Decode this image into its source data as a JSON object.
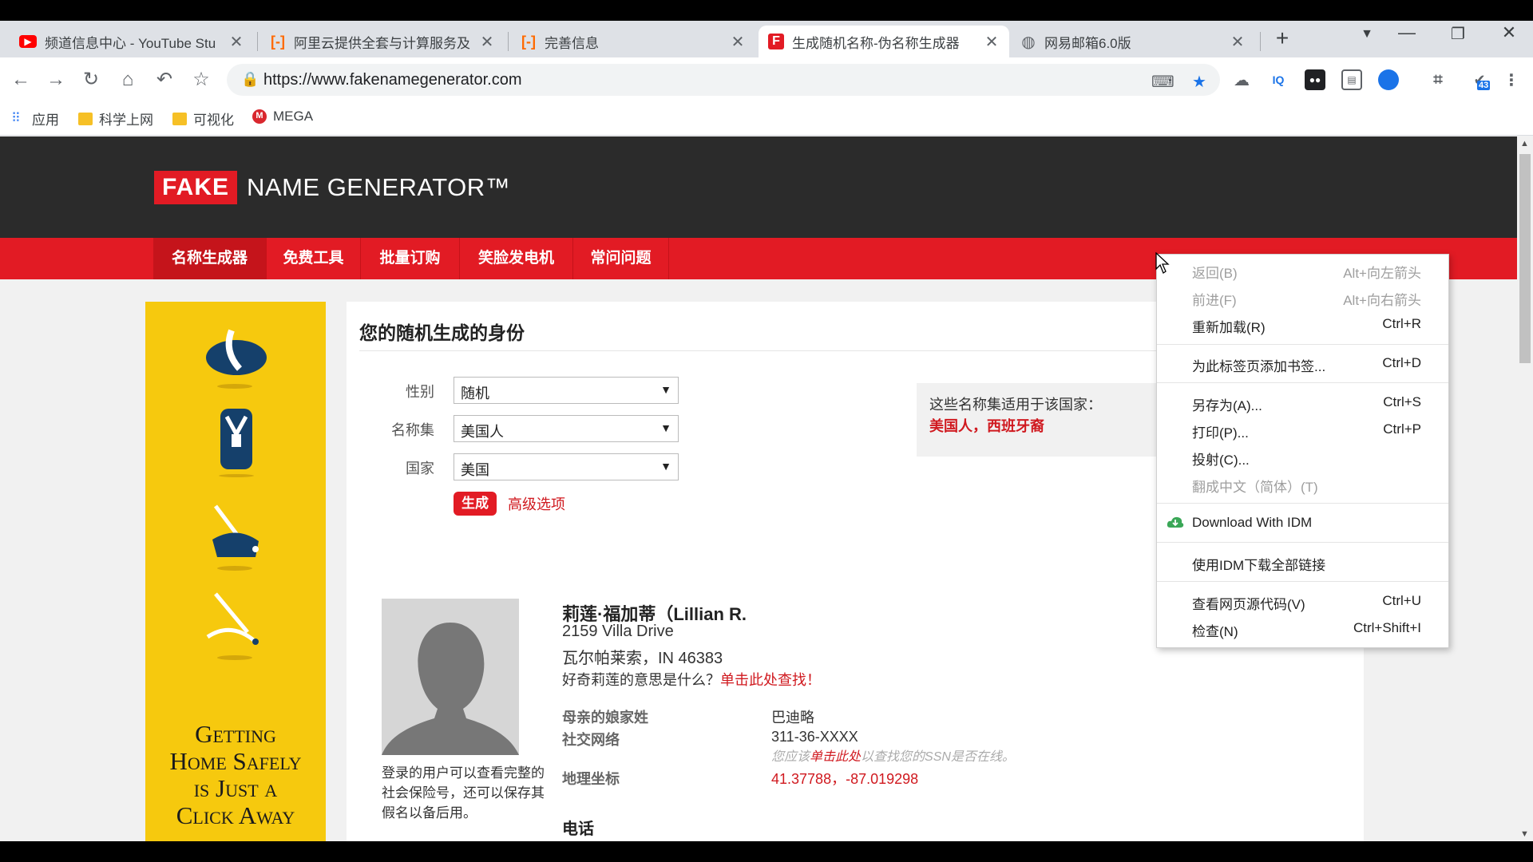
{
  "browser": {
    "tabs": [
      {
        "title": "频道信息中心 - YouTube Stu",
        "icon": "youtube-icon",
        "color": "#ff0000"
      },
      {
        "title": "阿里云提供全套与计算服务及",
        "icon": "aliyun-icon",
        "color": "#ff6a00"
      },
      {
        "title": "完善信息",
        "icon": "aliyun-icon",
        "color": "#ff6a00"
      },
      {
        "title": "生成随机名称-伪名称生成器",
        "icon": "fakename-icon",
        "color": "#e21b24",
        "active": true
      },
      {
        "title": "网易邮箱6.0版",
        "icon": "globe-icon",
        "color": "#5f6368"
      }
    ],
    "new_tab": "+",
    "url": "https://www.fakenamegenerator.com",
    "bookmarks": [
      {
        "label": "应用",
        "icon": "apps-grid-icon"
      },
      {
        "label": "科学上网",
        "icon": "folder-icon"
      },
      {
        "label": "可视化",
        "icon": "folder-icon"
      },
      {
        "label": "MEGA",
        "icon": "mega-icon"
      }
    ],
    "extension_badge": "43"
  },
  "site": {
    "logo_fake": "FAKE",
    "logo_rest": "NAME GENERATOR™",
    "nav": [
      "名称生成器",
      "免费工具",
      "批量订购",
      "笑脸发电机",
      "常问问题"
    ]
  },
  "ad": {
    "text_lines": [
      "Getting",
      "Home Safely",
      "is Just a",
      "Click Away"
    ]
  },
  "form": {
    "title": "您的随机生成的身份",
    "gender_label": "性别",
    "gender_value": "随机",
    "nameset_label": "名称集",
    "nameset_value": "美国人",
    "country_label": "国家",
    "country_value": "美国",
    "generate_button": "生成",
    "advanced_link": "高级选项",
    "note_line1": "这些名称集适用于该国家：",
    "note_line2": "美国人，西班牙裔"
  },
  "identity": {
    "name": "莉莲·福加蒂（Lillian R.",
    "address_line1": "2159 Villa Drive",
    "address_line2": "瓦尔帕莱索，IN 46383",
    "curious_text": "好奇莉莲的意思是什么？",
    "curious_link": "单击此处查找！",
    "login_note": "登录的用户可以查看完整的社会保险号，还可以保存其假名以备后用。",
    "fields": [
      {
        "key": "母亲的娘家姓",
        "value": "巴迪略"
      },
      {
        "key": "社交网络",
        "value": "311-36-XXXX"
      },
      {
        "key": "地理坐标",
        "value": "41.37788，-87.019298"
      }
    ],
    "ssn_hint_pre": "您应该",
    "ssn_hint_link": "单击此处",
    "ssn_hint_post": "以查找您的SSN是否在线。",
    "phone_heading": "电话"
  },
  "context_menu": {
    "items": [
      {
        "label": "返回(B)",
        "shortcut": "Alt+向左箭头",
        "disabled": true
      },
      {
        "label": "前进(F)",
        "shortcut": "Alt+向右箭头",
        "disabled": true
      },
      {
        "label": "重新加载(R)",
        "shortcut": "Ctrl+R"
      },
      {
        "label": "为此标签页添加书签...",
        "shortcut": "Ctrl+D"
      },
      {
        "label": "另存为(A)...",
        "shortcut": "Ctrl+S"
      },
      {
        "label": "打印(P)...",
        "shortcut": "Ctrl+P"
      },
      {
        "label": "投射(C)...",
        "shortcut": ""
      },
      {
        "label": "翻成中文（简体）(T)",
        "shortcut": "",
        "disabled": true
      },
      {
        "label": "Download With IDM",
        "shortcut": "",
        "icon": "idm-cloud-icon"
      },
      {
        "label": "使用IDM下载全部链接",
        "shortcut": ""
      },
      {
        "label": "查看网页源代码(V)",
        "shortcut": "Ctrl+U"
      },
      {
        "label": "检查(N)",
        "shortcut": "Ctrl+Shift+I"
      }
    ]
  },
  "colors": {
    "brand_red": "#e21b24",
    "header_dark": "#2b2b2b",
    "ad_yellow": "#f6c90e"
  }
}
